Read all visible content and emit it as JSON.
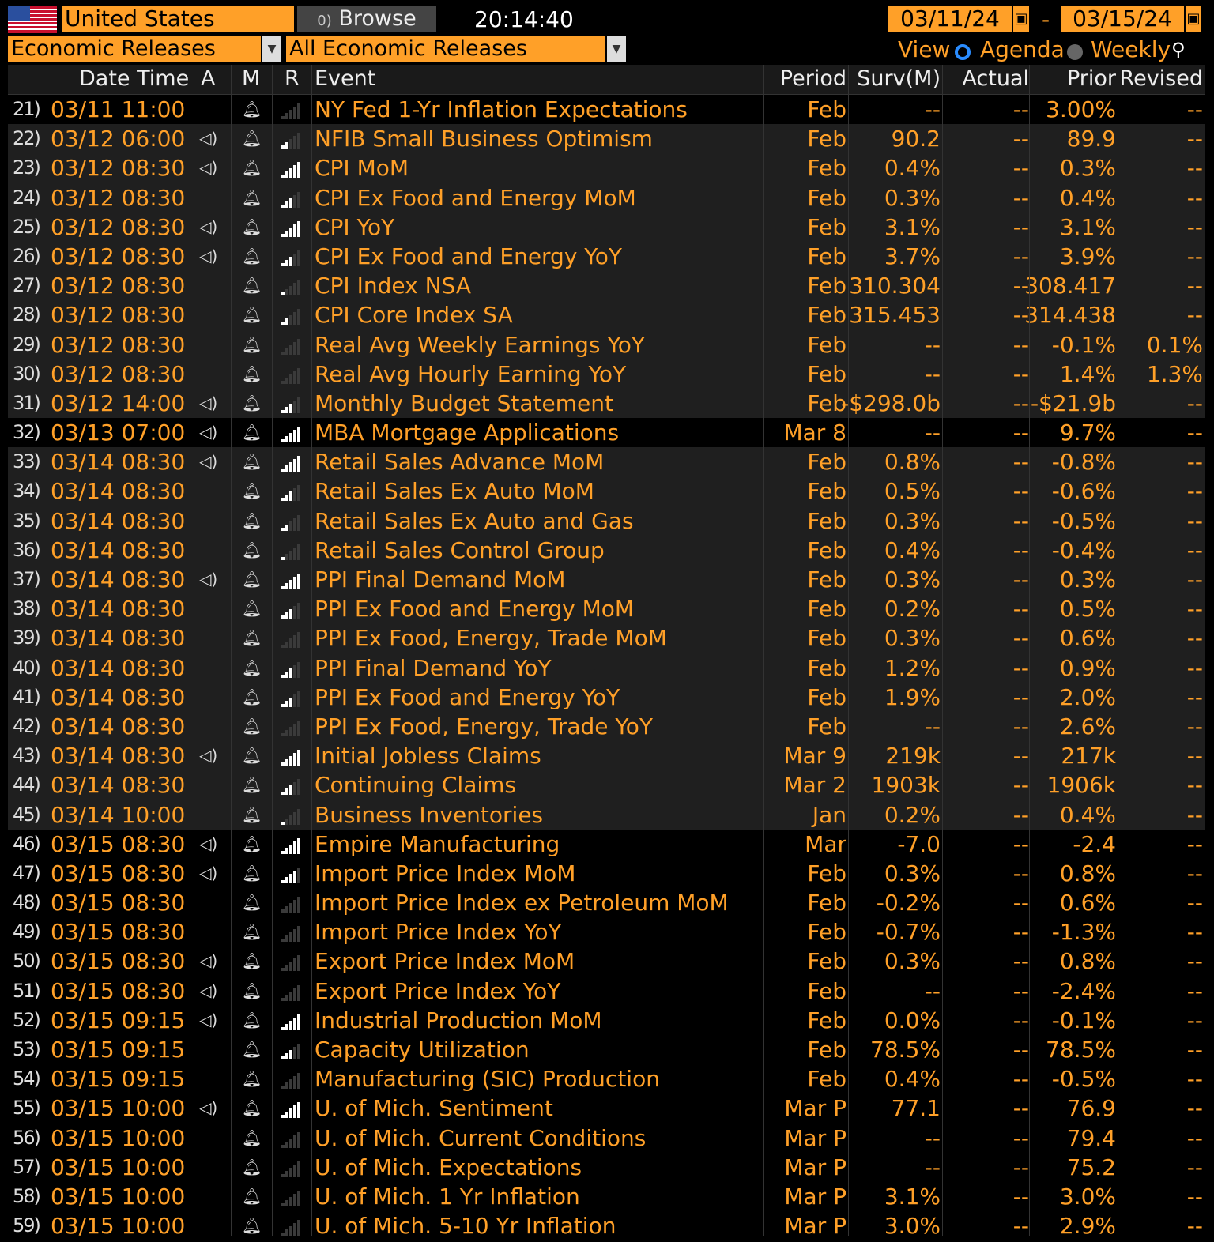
{
  "toolbar": {
    "country": "United States",
    "browse_label": "Browse",
    "browse_prefix": "0)",
    "clock": "20:14:40",
    "start_date": "03/11/24",
    "date_separator": "-",
    "end_date": "03/15/24",
    "category": "Economic Releases",
    "release_filter": "All Economic Releases",
    "view_label": "View",
    "view_agenda": "Agenda",
    "view_weekly": "Weekly"
  },
  "columns": {
    "datetime": "Date Time",
    "a": "A",
    "m": "M",
    "r": "R",
    "event": "Event",
    "period": "Period",
    "surv": "Surv(M)",
    "actual": "Actual",
    "prior": "Prior",
    "revised": "Revised"
  },
  "colors": {
    "accent": "#ffa028",
    "background": "#000000",
    "row_alt": "#1f1f1f"
  },
  "rows": [
    {
      "n": "21)",
      "dt": "03/11 11:00",
      "alert": false,
      "rel": 0,
      "event": "NY Fed 1-Yr Inflation Expectations",
      "period": "Feb",
      "surv": "--",
      "actual": "--",
      "prior": "3.00%",
      "revised": "--",
      "shade": "dark"
    },
    {
      "n": "22)",
      "dt": "03/12 06:00",
      "alert": true,
      "rel": 2,
      "event": "NFIB Small Business Optimism",
      "period": "Feb",
      "surv": "90.2",
      "actual": "--",
      "prior": "89.9",
      "revised": "--",
      "shade": "grey"
    },
    {
      "n": "23)",
      "dt": "03/12 08:30",
      "alert": true,
      "rel": 5,
      "event": "CPI MoM",
      "period": "Feb",
      "surv": "0.4%",
      "actual": "--",
      "prior": "0.3%",
      "revised": "--",
      "shade": "grey"
    },
    {
      "n": "24)",
      "dt": "03/12 08:30",
      "alert": false,
      "rel": 3,
      "event": "CPI Ex Food and Energy MoM",
      "period": "Feb",
      "surv": "0.3%",
      "actual": "--",
      "prior": "0.4%",
      "revised": "--",
      "shade": "grey"
    },
    {
      "n": "25)",
      "dt": "03/12 08:30",
      "alert": true,
      "rel": 5,
      "event": "CPI YoY",
      "period": "Feb",
      "surv": "3.1%",
      "actual": "--",
      "prior": "3.1%",
      "revised": "--",
      "shade": "grey"
    },
    {
      "n": "26)",
      "dt": "03/12 08:30",
      "alert": true,
      "rel": 3,
      "event": "CPI Ex Food and Energy YoY",
      "period": "Feb",
      "surv": "3.7%",
      "actual": "--",
      "prior": "3.9%",
      "revised": "--",
      "shade": "grey"
    },
    {
      "n": "27)",
      "dt": "03/12 08:30",
      "alert": false,
      "rel": 1,
      "event": "CPI Index NSA",
      "period": "Feb",
      "surv": "310.304",
      "actual": "--",
      "prior": "308.417",
      "revised": "--",
      "shade": "grey"
    },
    {
      "n": "28)",
      "dt": "03/12 08:30",
      "alert": false,
      "rel": 2,
      "event": "CPI Core Index SA",
      "period": "Feb",
      "surv": "315.453",
      "actual": "--",
      "prior": "314.438",
      "revised": "--",
      "shade": "grey"
    },
    {
      "n": "29)",
      "dt": "03/12 08:30",
      "alert": false,
      "rel": 0,
      "event": "Real Avg Weekly Earnings YoY",
      "period": "Feb",
      "surv": "--",
      "actual": "--",
      "prior": "-0.1%",
      "revised": "0.1%",
      "shade": "grey"
    },
    {
      "n": "30)",
      "dt": "03/12 08:30",
      "alert": false,
      "rel": 0,
      "event": "Real Avg Hourly Earning YoY",
      "period": "Feb",
      "surv": "--",
      "actual": "--",
      "prior": "1.4%",
      "revised": "1.3%",
      "shade": "grey"
    },
    {
      "n": "31)",
      "dt": "03/12 14:00",
      "alert": true,
      "rel": 3,
      "event": "Monthly Budget Statement",
      "period": "Feb",
      "surv": "-$298.0b",
      "actual": "--",
      "prior": "-$21.9b",
      "revised": "--",
      "shade": "grey"
    },
    {
      "n": "32)",
      "dt": "03/13 07:00",
      "alert": true,
      "rel": 5,
      "event": "MBA Mortgage Applications",
      "period": "Mar 8",
      "surv": "--",
      "actual": "--",
      "prior": "9.7%",
      "revised": "--",
      "shade": "dark"
    },
    {
      "n": "33)",
      "dt": "03/14 08:30",
      "alert": true,
      "rel": 5,
      "event": "Retail Sales Advance MoM",
      "period": "Feb",
      "surv": "0.8%",
      "actual": "--",
      "prior": "-0.8%",
      "revised": "--",
      "shade": "grey"
    },
    {
      "n": "34)",
      "dt": "03/14 08:30",
      "alert": false,
      "rel": 3,
      "event": "Retail Sales Ex Auto MoM",
      "period": "Feb",
      "surv": "0.5%",
      "actual": "--",
      "prior": "-0.6%",
      "revised": "--",
      "shade": "grey"
    },
    {
      "n": "35)",
      "dt": "03/14 08:30",
      "alert": false,
      "rel": 2,
      "event": "Retail Sales Ex Auto and Gas",
      "period": "Feb",
      "surv": "0.3%",
      "actual": "--",
      "prior": "-0.5%",
      "revised": "--",
      "shade": "grey"
    },
    {
      "n": "36)",
      "dt": "03/14 08:30",
      "alert": false,
      "rel": 1,
      "event": "Retail Sales Control Group",
      "period": "Feb",
      "surv": "0.4%",
      "actual": "--",
      "prior": "-0.4%",
      "revised": "--",
      "shade": "grey"
    },
    {
      "n": "37)",
      "dt": "03/14 08:30",
      "alert": true,
      "rel": 5,
      "event": "PPI Final Demand MoM",
      "period": "Feb",
      "surv": "0.3%",
      "actual": "--",
      "prior": "0.3%",
      "revised": "--",
      "shade": "grey"
    },
    {
      "n": "38)",
      "dt": "03/14 08:30",
      "alert": false,
      "rel": 3,
      "event": "PPI Ex Food and Energy MoM",
      "period": "Feb",
      "surv": "0.2%",
      "actual": "--",
      "prior": "0.5%",
      "revised": "--",
      "shade": "grey"
    },
    {
      "n": "39)",
      "dt": "03/14 08:30",
      "alert": false,
      "rel": 0,
      "event": "PPI Ex Food, Energy, Trade MoM",
      "period": "Feb",
      "surv": "0.3%",
      "actual": "--",
      "prior": "0.6%",
      "revised": "--",
      "shade": "grey"
    },
    {
      "n": "40)",
      "dt": "03/14 08:30",
      "alert": false,
      "rel": 3,
      "event": "PPI Final Demand YoY",
      "period": "Feb",
      "surv": "1.2%",
      "actual": "--",
      "prior": "0.9%",
      "revised": "--",
      "shade": "grey"
    },
    {
      "n": "41)",
      "dt": "03/14 08:30",
      "alert": false,
      "rel": 3,
      "event": "PPI Ex Food and Energy YoY",
      "period": "Feb",
      "surv": "1.9%",
      "actual": "--",
      "prior": "2.0%",
      "revised": "--",
      "shade": "grey"
    },
    {
      "n": "42)",
      "dt": "03/14 08:30",
      "alert": false,
      "rel": 0,
      "event": "PPI Ex Food, Energy, Trade YoY",
      "period": "Feb",
      "surv": "--",
      "actual": "--",
      "prior": "2.6%",
      "revised": "--",
      "shade": "grey"
    },
    {
      "n": "43)",
      "dt": "03/14 08:30",
      "alert": true,
      "rel": 5,
      "event": "Initial Jobless Claims",
      "period": "Mar 9",
      "surv": "219k",
      "actual": "--",
      "prior": "217k",
      "revised": "--",
      "shade": "grey"
    },
    {
      "n": "44)",
      "dt": "03/14 08:30",
      "alert": false,
      "rel": 3,
      "event": "Continuing Claims",
      "period": "Mar 2",
      "surv": "1903k",
      "actual": "--",
      "prior": "1906k",
      "revised": "--",
      "shade": "grey"
    },
    {
      "n": "45)",
      "dt": "03/14 10:00",
      "alert": false,
      "rel": 1,
      "event": "Business Inventories",
      "period": "Jan",
      "surv": "0.2%",
      "actual": "--",
      "prior": "0.4%",
      "revised": "--",
      "shade": "grey"
    },
    {
      "n": "46)",
      "dt": "03/15 08:30",
      "alert": true,
      "rel": 5,
      "event": "Empire Manufacturing",
      "period": "Mar",
      "surv": "-7.0",
      "actual": "--",
      "prior": "-2.4",
      "revised": "--",
      "shade": "dark"
    },
    {
      "n": "47)",
      "dt": "03/15 08:30",
      "alert": true,
      "rel": 4,
      "event": "Import Price Index MoM",
      "period": "Feb",
      "surv": "0.3%",
      "actual": "--",
      "prior": "0.8%",
      "revised": "--",
      "shade": "dark"
    },
    {
      "n": "48)",
      "dt": "03/15 08:30",
      "alert": false,
      "rel": 0,
      "event": "Import Price Index ex Petroleum MoM",
      "period": "Feb",
      "surv": "-0.2%",
      "actual": "--",
      "prior": "0.6%",
      "revised": "--",
      "shade": "dark"
    },
    {
      "n": "49)",
      "dt": "03/15 08:30",
      "alert": false,
      "rel": 0,
      "event": "Import Price Index YoY",
      "period": "Feb",
      "surv": "-0.7%",
      "actual": "--",
      "prior": "-1.3%",
      "revised": "--",
      "shade": "dark"
    },
    {
      "n": "50)",
      "dt": "03/15 08:30",
      "alert": true,
      "rel": 0,
      "event": "Export Price Index MoM",
      "period": "Feb",
      "surv": "0.3%",
      "actual": "--",
      "prior": "0.8%",
      "revised": "--",
      "shade": "dark"
    },
    {
      "n": "51)",
      "dt": "03/15 08:30",
      "alert": true,
      "rel": 0,
      "event": "Export Price Index YoY",
      "period": "Feb",
      "surv": "--",
      "actual": "--",
      "prior": "-2.4%",
      "revised": "--",
      "shade": "dark"
    },
    {
      "n": "52)",
      "dt": "03/15 09:15",
      "alert": true,
      "rel": 5,
      "event": "Industrial Production MoM",
      "period": "Feb",
      "surv": "0.0%",
      "actual": "--",
      "prior": "-0.1%",
      "revised": "--",
      "shade": "dark"
    },
    {
      "n": "53)",
      "dt": "03/15 09:15",
      "alert": false,
      "rel": 3,
      "event": "Capacity Utilization",
      "period": "Feb",
      "surv": "78.5%",
      "actual": "--",
      "prior": "78.5%",
      "revised": "--",
      "shade": "dark"
    },
    {
      "n": "54)",
      "dt": "03/15 09:15",
      "alert": false,
      "rel": 0,
      "event": "Manufacturing (SIC) Production",
      "period": "Feb",
      "surv": "0.4%",
      "actual": "--",
      "prior": "-0.5%",
      "revised": "--",
      "shade": "dark"
    },
    {
      "n": "55)",
      "dt": "03/15 10:00",
      "alert": true,
      "rel": 5,
      "event": "U. of Mich. Sentiment",
      "period": "Mar P",
      "surv": "77.1",
      "actual": "--",
      "prior": "76.9",
      "revised": "--",
      "shade": "dark"
    },
    {
      "n": "56)",
      "dt": "03/15 10:00",
      "alert": false,
      "rel": 0,
      "event": "U. of Mich. Current Conditions",
      "period": "Mar P",
      "surv": "--",
      "actual": "--",
      "prior": "79.4",
      "revised": "--",
      "shade": "dark"
    },
    {
      "n": "57)",
      "dt": "03/15 10:00",
      "alert": false,
      "rel": 0,
      "event": "U. of Mich. Expectations",
      "period": "Mar P",
      "surv": "--",
      "actual": "--",
      "prior": "75.2",
      "revised": "--",
      "shade": "dark"
    },
    {
      "n": "58)",
      "dt": "03/15 10:00",
      "alert": false,
      "rel": 0,
      "event": "U. of Mich. 1 Yr Inflation",
      "period": "Mar P",
      "surv": "3.1%",
      "actual": "--",
      "prior": "3.0%",
      "revised": "--",
      "shade": "dark"
    },
    {
      "n": "59)",
      "dt": "03/15 10:00",
      "alert": false,
      "rel": 0,
      "event": "U. of Mich. 5-10 Yr Inflation",
      "period": "Mar P",
      "surv": "3.0%",
      "actual": "--",
      "prior": "2.9%",
      "revised": "--",
      "shade": "dark"
    }
  ]
}
